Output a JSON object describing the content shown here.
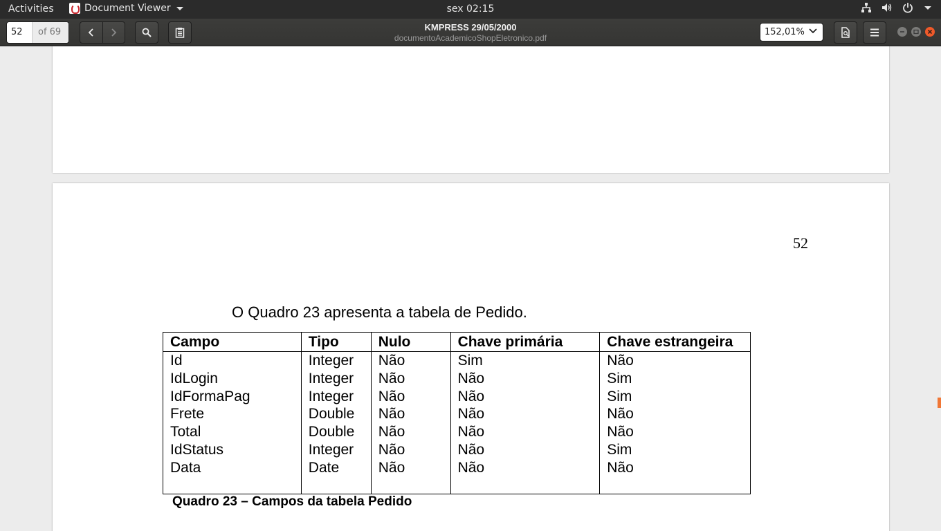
{
  "topbar": {
    "activities": "Activities",
    "app_name": "Document Viewer",
    "clock": "sex 02:15",
    "icons": [
      "network-icon",
      "volume-icon",
      "power-icon",
      "chevron-down-icon"
    ]
  },
  "toolbar": {
    "page_current": "52",
    "page_total": "of 69",
    "doc_title": "KMPRESS 29/05/2000",
    "file_name": "documentoAcademicoShopEletronico.pdf",
    "zoom": "152,01%"
  },
  "document": {
    "page_number": "52",
    "intro": "O Quadro 23 apresenta a tabela de Pedido.",
    "table": {
      "headers": [
        "Campo",
        "Tipo",
        "Nulo",
        "Chave primária",
        "Chave estrangeira"
      ],
      "rows": [
        [
          "Id",
          "Integer",
          "Não",
          "Sim",
          "Não"
        ],
        [
          "IdLogin",
          "Integer",
          "Não",
          "Não",
          "Sim"
        ],
        [
          "IdFormaPag",
          "Integer",
          "Não",
          "Não",
          "Sim"
        ],
        [
          "Frete",
          "Double",
          "Não",
          "Não",
          "Não"
        ],
        [
          "Total",
          "Double",
          "Não",
          "Não",
          "Não"
        ],
        [
          "IdStatus",
          "Integer",
          "Não",
          "Não",
          "Sim"
        ],
        [
          "Data",
          "Date",
          "Não",
          "Não",
          "Não"
        ]
      ]
    },
    "caption": "Quadro 23 – Campos da tabela Pedido"
  },
  "colors": {
    "topbar_bg": "#2b2b2b",
    "headerbar_bg": "#3c3c3a",
    "close_button": "#f05a2a",
    "scroll_indicator": "#f07736"
  }
}
